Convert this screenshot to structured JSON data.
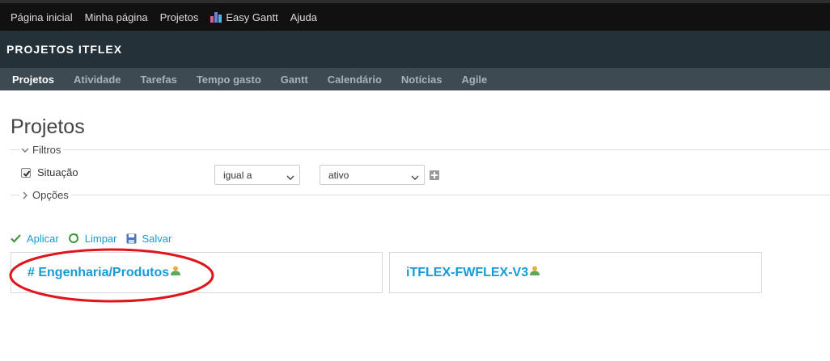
{
  "top_menu": {
    "items": [
      "Página inicial",
      "Minha página",
      "Projetos",
      "Easy Gantt",
      "Ajuda"
    ]
  },
  "header": {
    "title": "PROJETOS ITFLEX"
  },
  "main_menu": {
    "items": [
      "Projetos",
      "Atividade",
      "Tarefas",
      "Tempo gasto",
      "Gantt",
      "Calendário",
      "Notícias",
      "Agile"
    ],
    "selected": "Projetos"
  },
  "page": {
    "title": "Projetos"
  },
  "filters": {
    "legend": "Filtros",
    "row": {
      "checked": true,
      "label": "Situação",
      "operator": "igual a",
      "value": "ativo"
    }
  },
  "options": {
    "legend": "Opções"
  },
  "buttons": {
    "apply": "Aplicar",
    "clear": "Limpar",
    "save": "Salvar"
  },
  "projects": [
    {
      "name": "# Engenharia/Produtos"
    },
    {
      "name": "iTFLEX-FWFLEX-V3"
    }
  ],
  "colors": {
    "link": "#169bd5",
    "header_bg": "#253139",
    "main_menu_bg": "#3e4a52",
    "top_menu_bg": "#111111",
    "annotation": "#e0141b"
  }
}
